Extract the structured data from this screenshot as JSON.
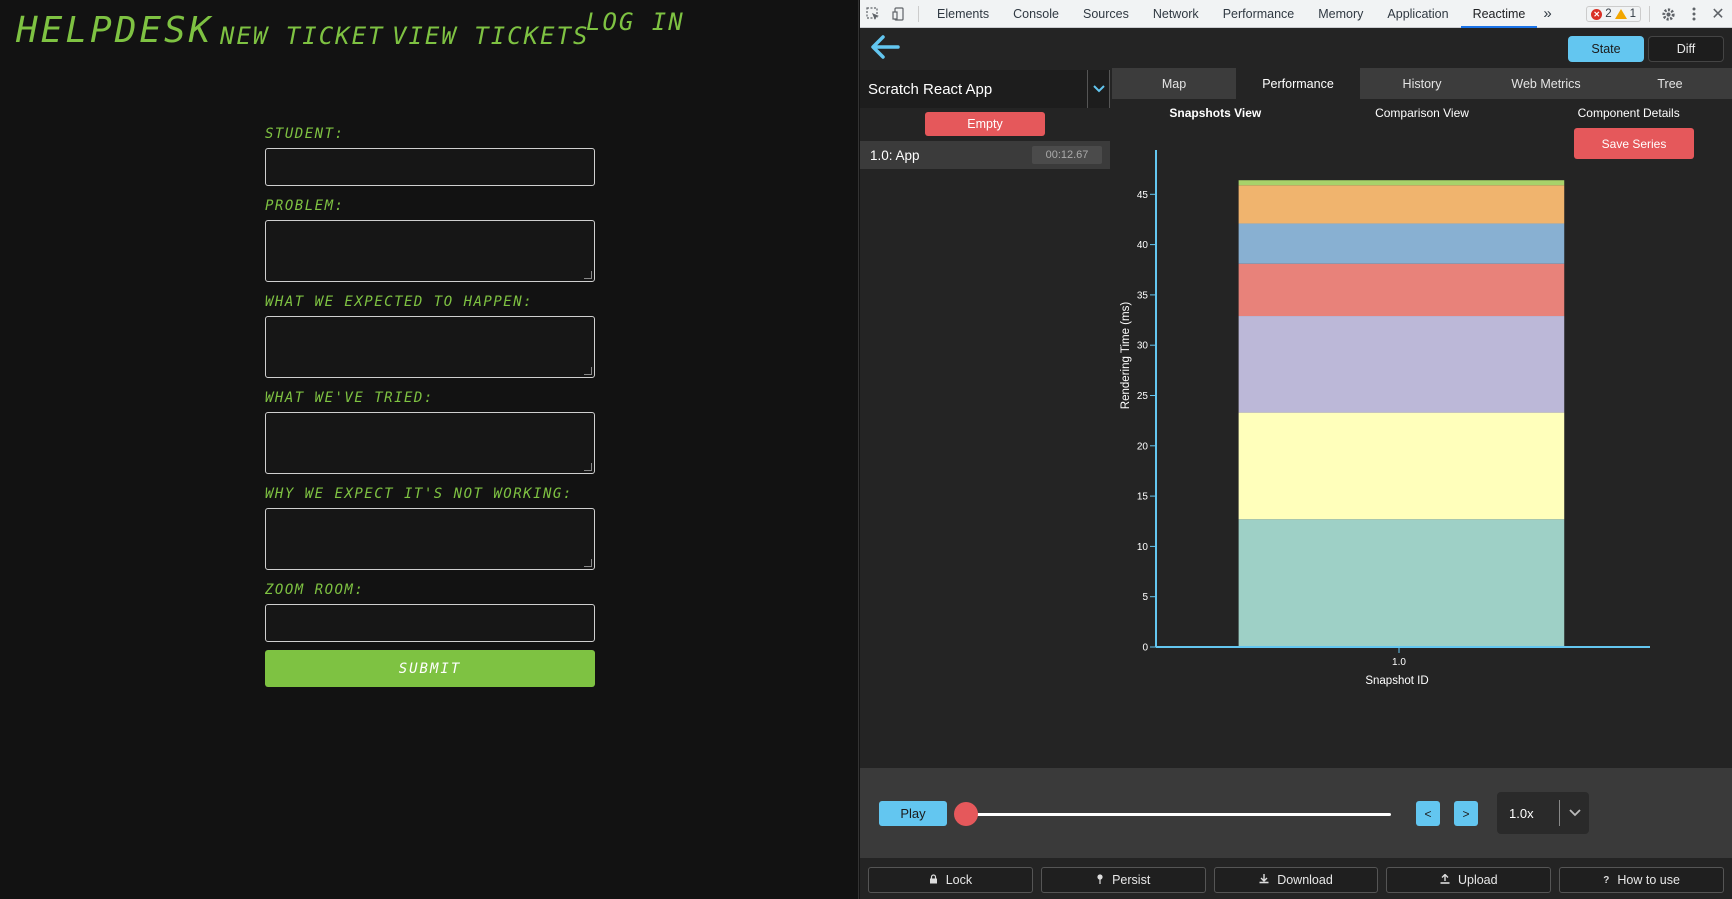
{
  "app": {
    "brand": "HELPDESK",
    "nav": {
      "new_ticket": "NEW TICKET",
      "view_tickets": "VIEW TICKETS",
      "log_in": "LOG IN"
    },
    "form": {
      "student_label": "STUDENT:",
      "problem_label": "PROBLEM:",
      "expected_label": "WHAT WE EXPECTED TO HAPPEN:",
      "tried_label": "WHAT WE'VE TRIED:",
      "why_label": "WHY WE EXPECT IT'S NOT WORKING:",
      "zoom_label": "ZOOM ROOM:",
      "submit_label": "SUBMIT"
    }
  },
  "devtools": {
    "tabs": [
      "Elements",
      "Console",
      "Sources",
      "Network",
      "Performance",
      "Memory",
      "Application",
      "Reactime"
    ],
    "active_tab": "Reactime",
    "more": "»",
    "errors": "2",
    "warnings": "1"
  },
  "reactime": {
    "state_label": "State",
    "diff_label": "Diff",
    "app_name": "Scratch React App",
    "empty_label": "Empty",
    "snapshot": {
      "label": "1.0: App",
      "time": "00:12.67"
    },
    "tabs": [
      "Map",
      "Performance",
      "History",
      "Web Metrics",
      "Tree"
    ],
    "active_tab": "Performance",
    "subtabs": [
      "Snapshots View",
      "Comparison View",
      "Component Details"
    ],
    "active_subtab": "Snapshots View",
    "save_series_label": "Save Series",
    "play_label": "Play",
    "prev_label": "<",
    "next_label": ">",
    "speed": "1.0x",
    "playback_progress": 0,
    "footer": [
      {
        "label": "Lock",
        "icon": "lock-icon"
      },
      {
        "label": "Persist",
        "icon": "pin-icon"
      },
      {
        "label": "Download",
        "icon": "download-icon"
      },
      {
        "label": "Upload",
        "icon": "upload-icon"
      },
      {
        "label": "How to use",
        "icon": "question-icon"
      }
    ]
  },
  "colors": {
    "lcd_green": "#7ec242",
    "accent_blue": "#63c6f0",
    "accent_red": "#e5585b"
  },
  "chart_data": {
    "type": "bar",
    "stacked": true,
    "categories": [
      "1.0"
    ],
    "xlabel": "Snapshot ID",
    "ylabel": "Rendering Time (ms)",
    "ylim": [
      0,
      50
    ],
    "yticks": [
      0,
      5,
      10,
      15,
      20,
      25,
      30,
      35,
      40,
      45,
      50
    ],
    "series": [
      {
        "values": [
          12.7
        ],
        "color": "#9ed0c6"
      },
      {
        "values": [
          10.6
        ],
        "color": "#ffffbb"
      },
      {
        "values": [
          9.6
        ],
        "color": "#bcb8d8"
      },
      {
        "values": [
          5.2
        ],
        "color": "#e8827a"
      },
      {
        "values": [
          4.0
        ],
        "color": "#88b0d2"
      },
      {
        "values": [
          3.8
        ],
        "color": "#f0b46e"
      },
      {
        "values": [
          0.5
        ],
        "color": "#a8d26a"
      }
    ]
  }
}
